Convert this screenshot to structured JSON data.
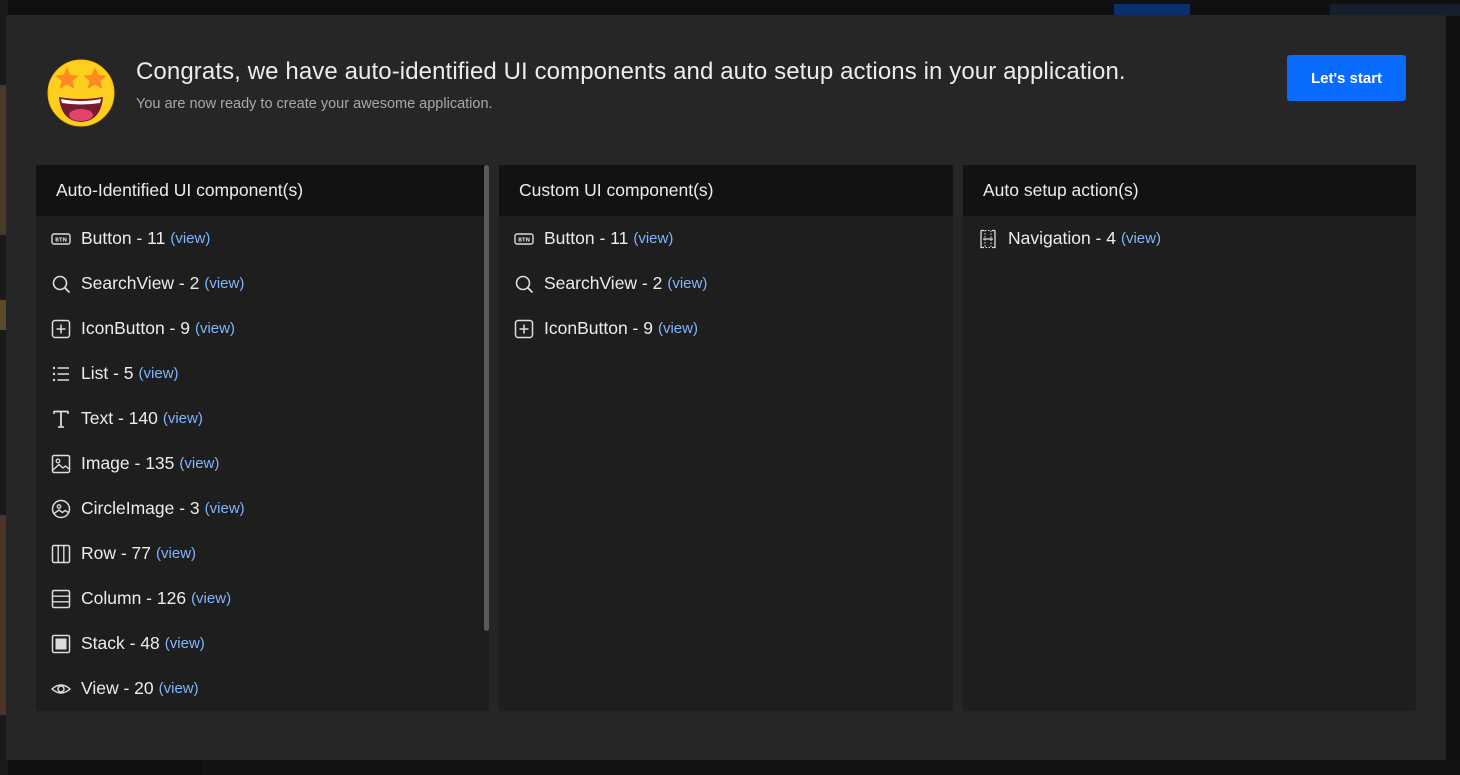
{
  "colors": {
    "accent": "#0a6cff",
    "link": "#7fb6ff",
    "modal_bg": "#262626",
    "panel_bg": "#1e1e1e",
    "panel_header_bg": "#121212"
  },
  "header": {
    "emoji_icon": "star-struck-emoji-icon",
    "title": "Congrats, we have auto-identified UI components and auto setup actions in your application.",
    "subtitle": "You are now ready to create your awesome application.",
    "start_label": "Let's start"
  },
  "panels": [
    {
      "title": "Auto-Identified UI component(s)",
      "items": [
        {
          "icon": "btn-icon",
          "label": "Button - 11",
          "link": "(view)"
        },
        {
          "icon": "search-icon",
          "label": "SearchView - 2",
          "link": "(view)"
        },
        {
          "icon": "plus-box-icon",
          "label": "IconButton - 9",
          "link": "(view)"
        },
        {
          "icon": "list-icon",
          "label": "List - 5",
          "link": "(view)"
        },
        {
          "icon": "text-icon",
          "label": "Text - 140",
          "link": "(view)"
        },
        {
          "icon": "image-icon",
          "label": "Image - 135",
          "link": "(view)"
        },
        {
          "icon": "circle-image-icon",
          "label": "CircleImage - 3",
          "link": "(view)"
        },
        {
          "icon": "row-icon",
          "label": "Row - 77",
          "link": "(view)"
        },
        {
          "icon": "column-icon",
          "label": "Column - 126",
          "link": "(view)"
        },
        {
          "icon": "stack-icon",
          "label": "Stack - 48",
          "link": "(view)"
        },
        {
          "icon": "eye-icon",
          "label": "View - 20",
          "link": "(view)"
        }
      ]
    },
    {
      "title": "Custom UI component(s)",
      "items": [
        {
          "icon": "btn-icon",
          "label": "Button - 11",
          "link": "(view)"
        },
        {
          "icon": "search-icon",
          "label": "SearchView - 2",
          "link": "(view)"
        },
        {
          "icon": "plus-box-icon",
          "label": "IconButton - 9",
          "link": "(view)"
        }
      ]
    },
    {
      "title": "Auto setup action(s)",
      "items": [
        {
          "icon": "navigation-icon",
          "label": "Navigation - 4",
          "link": "(view)"
        }
      ]
    }
  ]
}
